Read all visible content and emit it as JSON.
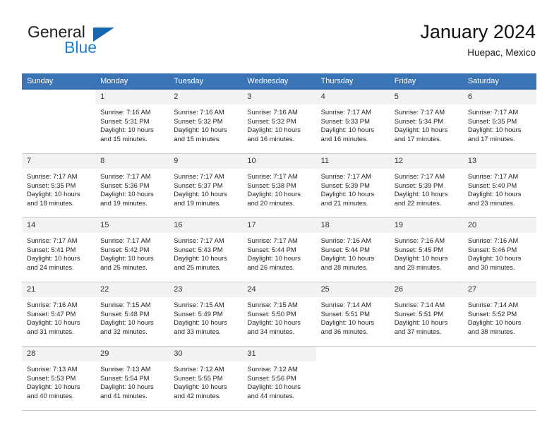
{
  "brand": {
    "name_top": "General",
    "name_bottom": "Blue",
    "triangle_color": "#1667b0",
    "blue_text_color": "#1f7fd0"
  },
  "header": {
    "title": "January 2024",
    "location": "Huepac, Mexico",
    "weekday_header_bg": "#3b74b4",
    "weekday_header_color": "#ffffff",
    "daynum_bg": "#f2f2f2"
  },
  "weekdays": [
    "Sunday",
    "Monday",
    "Tuesday",
    "Wednesday",
    "Thursday",
    "Friday",
    "Saturday"
  ],
  "weeks": [
    [
      {
        "day": "",
        "empty": true
      },
      {
        "day": "1",
        "sunrise": "Sunrise: 7:16 AM",
        "sunset": "Sunset: 5:31 PM",
        "daylight1": "Daylight: 10 hours",
        "daylight2": "and 15 minutes."
      },
      {
        "day": "2",
        "sunrise": "Sunrise: 7:16 AM",
        "sunset": "Sunset: 5:32 PM",
        "daylight1": "Daylight: 10 hours",
        "daylight2": "and 15 minutes."
      },
      {
        "day": "3",
        "sunrise": "Sunrise: 7:16 AM",
        "sunset": "Sunset: 5:32 PM",
        "daylight1": "Daylight: 10 hours",
        "daylight2": "and 16 minutes."
      },
      {
        "day": "4",
        "sunrise": "Sunrise: 7:17 AM",
        "sunset": "Sunset: 5:33 PM",
        "daylight1": "Daylight: 10 hours",
        "daylight2": "and 16 minutes."
      },
      {
        "day": "5",
        "sunrise": "Sunrise: 7:17 AM",
        "sunset": "Sunset: 5:34 PM",
        "daylight1": "Daylight: 10 hours",
        "daylight2": "and 17 minutes."
      },
      {
        "day": "6",
        "sunrise": "Sunrise: 7:17 AM",
        "sunset": "Sunset: 5:35 PM",
        "daylight1": "Daylight: 10 hours",
        "daylight2": "and 17 minutes."
      }
    ],
    [
      {
        "day": "7",
        "sunrise": "Sunrise: 7:17 AM",
        "sunset": "Sunset: 5:35 PM",
        "daylight1": "Daylight: 10 hours",
        "daylight2": "and 18 minutes."
      },
      {
        "day": "8",
        "sunrise": "Sunrise: 7:17 AM",
        "sunset": "Sunset: 5:36 PM",
        "daylight1": "Daylight: 10 hours",
        "daylight2": "and 19 minutes."
      },
      {
        "day": "9",
        "sunrise": "Sunrise: 7:17 AM",
        "sunset": "Sunset: 5:37 PM",
        "daylight1": "Daylight: 10 hours",
        "daylight2": "and 19 minutes."
      },
      {
        "day": "10",
        "sunrise": "Sunrise: 7:17 AM",
        "sunset": "Sunset: 5:38 PM",
        "daylight1": "Daylight: 10 hours",
        "daylight2": "and 20 minutes."
      },
      {
        "day": "11",
        "sunrise": "Sunrise: 7:17 AM",
        "sunset": "Sunset: 5:39 PM",
        "daylight1": "Daylight: 10 hours",
        "daylight2": "and 21 minutes."
      },
      {
        "day": "12",
        "sunrise": "Sunrise: 7:17 AM",
        "sunset": "Sunset: 5:39 PM",
        "daylight1": "Daylight: 10 hours",
        "daylight2": "and 22 minutes."
      },
      {
        "day": "13",
        "sunrise": "Sunrise: 7:17 AM",
        "sunset": "Sunset: 5:40 PM",
        "daylight1": "Daylight: 10 hours",
        "daylight2": "and 23 minutes."
      }
    ],
    [
      {
        "day": "14",
        "sunrise": "Sunrise: 7:17 AM",
        "sunset": "Sunset: 5:41 PM",
        "daylight1": "Daylight: 10 hours",
        "daylight2": "and 24 minutes."
      },
      {
        "day": "15",
        "sunrise": "Sunrise: 7:17 AM",
        "sunset": "Sunset: 5:42 PM",
        "daylight1": "Daylight: 10 hours",
        "daylight2": "and 25 minutes."
      },
      {
        "day": "16",
        "sunrise": "Sunrise: 7:17 AM",
        "sunset": "Sunset: 5:43 PM",
        "daylight1": "Daylight: 10 hours",
        "daylight2": "and 25 minutes."
      },
      {
        "day": "17",
        "sunrise": "Sunrise: 7:17 AM",
        "sunset": "Sunset: 5:44 PM",
        "daylight1": "Daylight: 10 hours",
        "daylight2": "and 26 minutes."
      },
      {
        "day": "18",
        "sunrise": "Sunrise: 7:16 AM",
        "sunset": "Sunset: 5:44 PM",
        "daylight1": "Daylight: 10 hours",
        "daylight2": "and 28 minutes."
      },
      {
        "day": "19",
        "sunrise": "Sunrise: 7:16 AM",
        "sunset": "Sunset: 5:45 PM",
        "daylight1": "Daylight: 10 hours",
        "daylight2": "and 29 minutes."
      },
      {
        "day": "20",
        "sunrise": "Sunrise: 7:16 AM",
        "sunset": "Sunset: 5:46 PM",
        "daylight1": "Daylight: 10 hours",
        "daylight2": "and 30 minutes."
      }
    ],
    [
      {
        "day": "21",
        "sunrise": "Sunrise: 7:16 AM",
        "sunset": "Sunset: 5:47 PM",
        "daylight1": "Daylight: 10 hours",
        "daylight2": "and 31 minutes."
      },
      {
        "day": "22",
        "sunrise": "Sunrise: 7:15 AM",
        "sunset": "Sunset: 5:48 PM",
        "daylight1": "Daylight: 10 hours",
        "daylight2": "and 32 minutes."
      },
      {
        "day": "23",
        "sunrise": "Sunrise: 7:15 AM",
        "sunset": "Sunset: 5:49 PM",
        "daylight1": "Daylight: 10 hours",
        "daylight2": "and 33 minutes."
      },
      {
        "day": "24",
        "sunrise": "Sunrise: 7:15 AM",
        "sunset": "Sunset: 5:50 PM",
        "daylight1": "Daylight: 10 hours",
        "daylight2": "and 34 minutes."
      },
      {
        "day": "25",
        "sunrise": "Sunrise: 7:14 AM",
        "sunset": "Sunset: 5:51 PM",
        "daylight1": "Daylight: 10 hours",
        "daylight2": "and 36 minutes."
      },
      {
        "day": "26",
        "sunrise": "Sunrise: 7:14 AM",
        "sunset": "Sunset: 5:51 PM",
        "daylight1": "Daylight: 10 hours",
        "daylight2": "and 37 minutes."
      },
      {
        "day": "27",
        "sunrise": "Sunrise: 7:14 AM",
        "sunset": "Sunset: 5:52 PM",
        "daylight1": "Daylight: 10 hours",
        "daylight2": "and 38 minutes."
      }
    ],
    [
      {
        "day": "28",
        "sunrise": "Sunrise: 7:13 AM",
        "sunset": "Sunset: 5:53 PM",
        "daylight1": "Daylight: 10 hours",
        "daylight2": "and 40 minutes."
      },
      {
        "day": "29",
        "sunrise": "Sunrise: 7:13 AM",
        "sunset": "Sunset: 5:54 PM",
        "daylight1": "Daylight: 10 hours",
        "daylight2": "and 41 minutes."
      },
      {
        "day": "30",
        "sunrise": "Sunrise: 7:12 AM",
        "sunset": "Sunset: 5:55 PM",
        "daylight1": "Daylight: 10 hours",
        "daylight2": "and 42 minutes."
      },
      {
        "day": "31",
        "sunrise": "Sunrise: 7:12 AM",
        "sunset": "Sunset: 5:56 PM",
        "daylight1": "Daylight: 10 hours",
        "daylight2": "and 44 minutes."
      },
      {
        "day": "",
        "empty": true
      },
      {
        "day": "",
        "empty": true
      },
      {
        "day": "",
        "empty": true
      }
    ]
  ]
}
